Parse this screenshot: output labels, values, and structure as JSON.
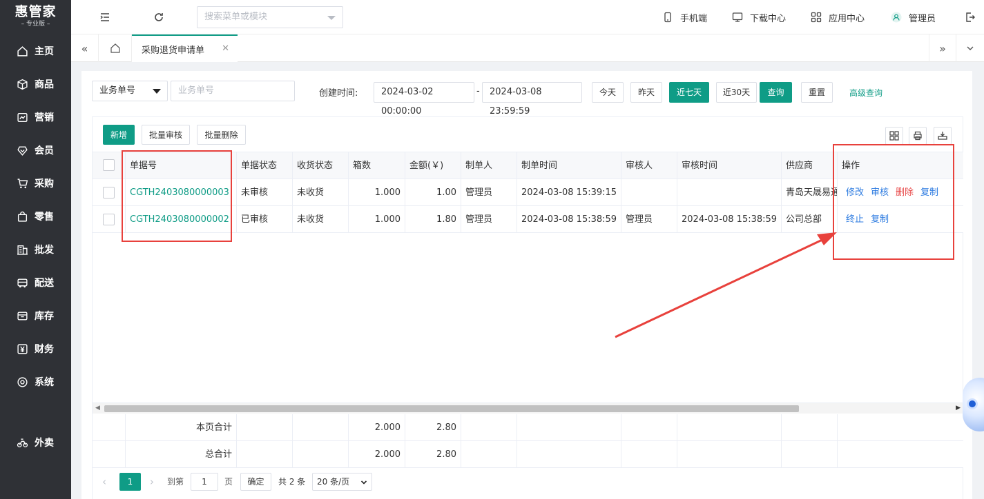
{
  "brand": {
    "name": "惠管家",
    "edition": "– 专业版 –"
  },
  "sidebar": {
    "items": [
      {
        "label": "主页",
        "icon": "home-icon"
      },
      {
        "label": "商品",
        "icon": "box-icon"
      },
      {
        "label": "营销",
        "icon": "chart-icon"
      },
      {
        "label": "会员",
        "icon": "member-icon"
      },
      {
        "label": "采购",
        "icon": "cart-icon"
      },
      {
        "label": "零售",
        "icon": "bag-icon"
      },
      {
        "label": "批发",
        "icon": "building-icon"
      },
      {
        "label": "配送",
        "icon": "truck-icon"
      },
      {
        "label": "库存",
        "icon": "inventory-icon"
      },
      {
        "label": "财务",
        "icon": "yen-icon"
      },
      {
        "label": "系统",
        "icon": "gear-icon"
      },
      {
        "label": "外卖",
        "icon": "bike-icon"
      }
    ]
  },
  "topbar": {
    "search_placeholder": "搜索菜单或模块",
    "mobile": "手机端",
    "download": "下载中心",
    "apps": "应用中心",
    "user": "管理员"
  },
  "tabs": {
    "active": "采购退货申请单"
  },
  "filters": {
    "field_select": "业务单号",
    "field_placeholder": "业务单号",
    "created_label": "创建时间:",
    "start": "2024-03-02 00:00:00",
    "sep": "-",
    "end": "2024-03-08 23:59:59",
    "today": "今天",
    "yesterday": "昨天",
    "last7": "近七天",
    "last30": "近30天",
    "query": "查询",
    "reset": "重置",
    "advanced": "高级查询"
  },
  "toolbar": {
    "add": "新增",
    "batch_audit": "批量审核",
    "batch_delete": "批量删除"
  },
  "table": {
    "headers": [
      "单据号",
      "单据状态",
      "收货状态",
      "箱数",
      "金额(￥)",
      "制单人",
      "制单时间",
      "审核人",
      "审核时间",
      "供应商",
      "操作"
    ],
    "rows": [
      {
        "no": "CGTH2403080000003",
        "status": "未审核",
        "recv": "未收货",
        "boxes": "1.000",
        "amount": "1.00",
        "creator": "管理员",
        "ctime": "2024-03-08 15:39:15",
        "auditor": "",
        "atime": "",
        "supplier": "青岛天晟易通",
        "actions": [
          "修改",
          "审核",
          "删除",
          "复制"
        ]
      },
      {
        "no": "CGTH2403080000002",
        "status": "已审核",
        "recv": "未收货",
        "boxes": "1.000",
        "amount": "1.80",
        "creator": "管理员",
        "ctime": "2024-03-08 15:38:59",
        "auditor": "管理员",
        "atime": "2024-03-08 15:38:59",
        "supplier": "公司总部",
        "actions": [
          "终止",
          "复制"
        ]
      }
    ],
    "page_total_label": "本页合计",
    "page_total_boxes": "2.000",
    "page_total_amount": "2.80",
    "grand_total_label": "总合计",
    "grand_total_boxes": "2.000",
    "grand_total_amount": "2.80"
  },
  "pager": {
    "current": "1",
    "goto": "到第",
    "page_input": "1",
    "page_unit": "页",
    "confirm": "确定",
    "total": "共 2 条",
    "size": "20 条/页"
  },
  "colors": {
    "primary": "#0f9c86",
    "link": "#2b7ae0",
    "danger": "#e84a4a",
    "highlight": "#e8413c"
  }
}
